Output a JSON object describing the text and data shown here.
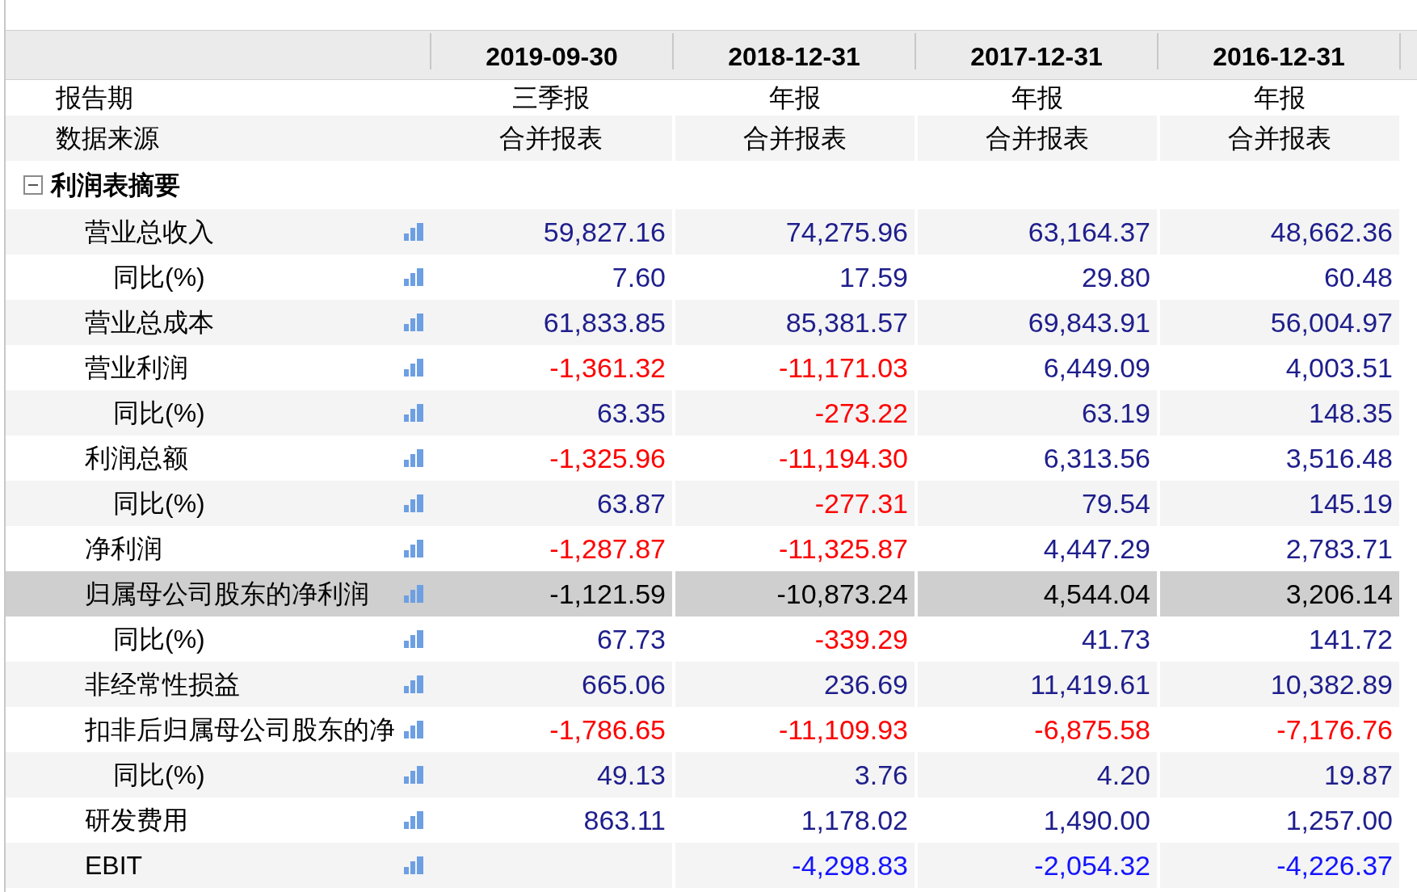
{
  "table": {
    "columns": [
      "2019-09-30",
      "2018-12-31",
      "2017-12-31",
      "2016-12-31"
    ],
    "info_rows": [
      {
        "label": "报告期",
        "values": [
          "三季报",
          "年报",
          "年报",
          "年报"
        ]
      },
      {
        "label": "数据来源",
        "values": [
          "合并报表",
          "合并报表",
          "合并报表",
          "合并报表"
        ]
      }
    ],
    "sections": [
      {
        "title": "利润表摘要",
        "expanded": true,
        "rows": [
          {
            "label": "营业总收入",
            "selected": false,
            "cells": [
              {
                "text": "59,827.16",
                "color": "#1e1e8c"
              },
              {
                "text": "74,275.96",
                "color": "#1e1e8c"
              },
              {
                "text": "63,164.37",
                "color": "#1e1e8c"
              },
              {
                "text": "48,662.36",
                "color": "#1e1e8c"
              }
            ],
            "children": [
              {
                "label": "同比(%)",
                "selected": false,
                "cells": [
                  {
                    "text": "7.60",
                    "color": "#1e1e8c"
                  },
                  {
                    "text": "17.59",
                    "color": "#1e1e8c"
                  },
                  {
                    "text": "29.80",
                    "color": "#1e1e8c"
                  },
                  {
                    "text": "60.48",
                    "color": "#1e1e8c"
                  }
                ]
              }
            ]
          },
          {
            "label": "营业总成本",
            "selected": false,
            "cells": [
              {
                "text": "61,833.85",
                "color": "#1e1e8c"
              },
              {
                "text": "85,381.57",
                "color": "#1e1e8c"
              },
              {
                "text": "69,843.91",
                "color": "#1e1e8c"
              },
              {
                "text": "56,004.97",
                "color": "#1e1e8c"
              }
            ]
          },
          {
            "label": "营业利润",
            "selected": false,
            "cells": [
              {
                "text": "-1,361.32",
                "color": "#ff0000"
              },
              {
                "text": "-11,171.03",
                "color": "#ff0000"
              },
              {
                "text": "6,449.09",
                "color": "#1e1e8c"
              },
              {
                "text": "4,003.51",
                "color": "#1e1e8c"
              }
            ],
            "children": [
              {
                "label": "同比(%)",
                "selected": false,
                "cells": [
                  {
                    "text": "63.35",
                    "color": "#1e1e8c"
                  },
                  {
                    "text": "-273.22",
                    "color": "#ff0000"
                  },
                  {
                    "text": "63.19",
                    "color": "#1e1e8c"
                  },
                  {
                    "text": "148.35",
                    "color": "#1e1e8c"
                  }
                ]
              }
            ]
          },
          {
            "label": "利润总额",
            "selected": false,
            "cells": [
              {
                "text": "-1,325.96",
                "color": "#ff0000"
              },
              {
                "text": "-11,194.30",
                "color": "#ff0000"
              },
              {
                "text": "6,313.56",
                "color": "#1e1e8c"
              },
              {
                "text": "3,516.48",
                "color": "#1e1e8c"
              }
            ],
            "children": [
              {
                "label": "同比(%)",
                "selected": false,
                "cells": [
                  {
                    "text": "63.87",
                    "color": "#1e1e8c"
                  },
                  {
                    "text": "-277.31",
                    "color": "#ff0000"
                  },
                  {
                    "text": "79.54",
                    "color": "#1e1e8c"
                  },
                  {
                    "text": "145.19",
                    "color": "#1e1e8c"
                  }
                ]
              }
            ]
          },
          {
            "label": "净利润",
            "selected": false,
            "cells": [
              {
                "text": "-1,287.87",
                "color": "#ff0000"
              },
              {
                "text": "-11,325.87",
                "color": "#ff0000"
              },
              {
                "text": "4,447.29",
                "color": "#1e1e8c"
              },
              {
                "text": "2,783.71",
                "color": "#1e1e8c"
              }
            ]
          },
          {
            "label": "归属母公司股东的净利润",
            "selected": true,
            "cells": [
              {
                "text": "-1,121.59",
                "color": "#000000"
              },
              {
                "text": "-10,873.24",
                "color": "#000000"
              },
              {
                "text": "4,544.04",
                "color": "#000000"
              },
              {
                "text": "3,206.14",
                "color": "#000000"
              }
            ],
            "children": [
              {
                "label": "同比(%)",
                "selected": false,
                "cells": [
                  {
                    "text": "67.73",
                    "color": "#1e1e8c"
                  },
                  {
                    "text": "-339.29",
                    "color": "#ff0000"
                  },
                  {
                    "text": "41.73",
                    "color": "#1e1e8c"
                  },
                  {
                    "text": "141.72",
                    "color": "#1e1e8c"
                  }
                ]
              }
            ]
          },
          {
            "label": "非经常性损益",
            "selected": false,
            "cells": [
              {
                "text": "665.06",
                "color": "#1e1e8c"
              },
              {
                "text": "236.69",
                "color": "#1e1e8c"
              },
              {
                "text": "11,419.61",
                "color": "#1e1e8c"
              },
              {
                "text": "10,382.89",
                "color": "#1e1e8c"
              }
            ]
          },
          {
            "label": "扣非后归属母公司股东的净",
            "selected": false,
            "cells": [
              {
                "text": "-1,786.65",
                "color": "#ff0000"
              },
              {
                "text": "-11,109.93",
                "color": "#ff0000"
              },
              {
                "text": "-6,875.58",
                "color": "#ff0000"
              },
              {
                "text": "-7,176.76",
                "color": "#ff0000"
              }
            ],
            "children": [
              {
                "label": "同比(%)",
                "selected": false,
                "cells": [
                  {
                    "text": "49.13",
                    "color": "#1e1e8c"
                  },
                  {
                    "text": "3.76",
                    "color": "#1e1e8c"
                  },
                  {
                    "text": "4.20",
                    "color": "#1e1e8c"
                  },
                  {
                    "text": "19.87",
                    "color": "#1e1e8c"
                  }
                ]
              }
            ]
          },
          {
            "label": "研发费用",
            "selected": false,
            "cells": [
              {
                "text": "863.11",
                "color": "#1e1e8c"
              },
              {
                "text": "1,178.02",
                "color": "#1e1e8c"
              },
              {
                "text": "1,490.00",
                "color": "#1e1e8c"
              },
              {
                "text": "1,257.00",
                "color": "#1e1e8c"
              }
            ]
          },
          {
            "label": "EBIT",
            "selected": false,
            "cells": [
              null,
              {
                "text": "-4,298.83",
                "color": "#1414ff"
              },
              {
                "text": "-2,054.32",
                "color": "#1414ff"
              },
              {
                "text": "-4,226.37",
                "color": "#1414ff"
              }
            ]
          }
        ]
      }
    ]
  }
}
